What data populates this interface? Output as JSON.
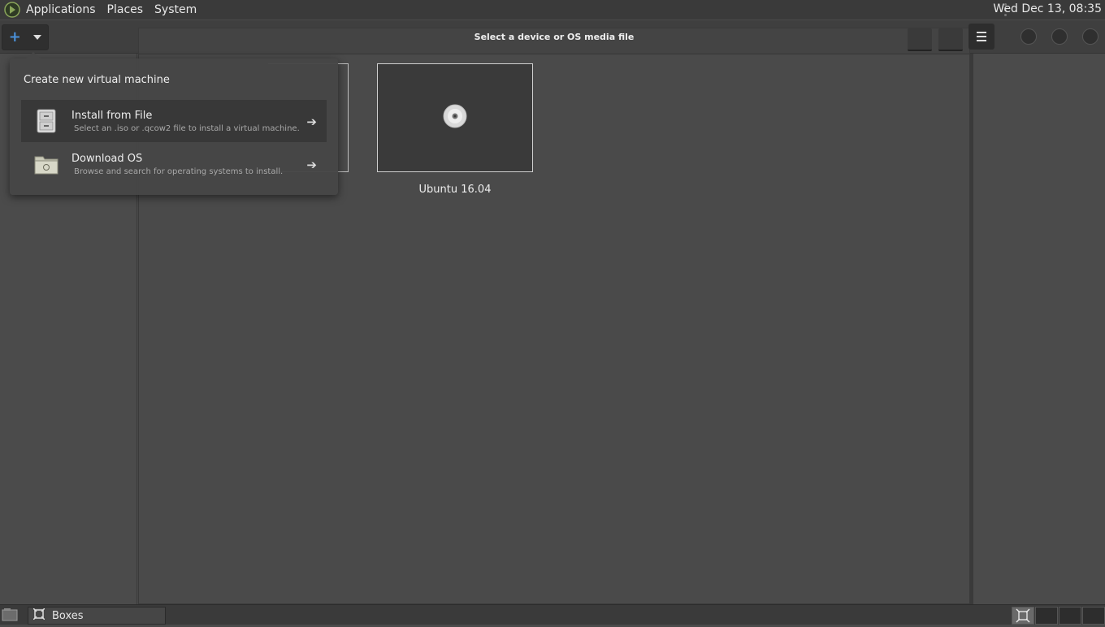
{
  "top_panel": {
    "menus": [
      "Applications",
      "Places",
      "System"
    ],
    "clock": "Wed Dec 13, 08:35"
  },
  "dialog": {
    "title": "Select a device or OS media file",
    "media": [
      {
        "label": "Ubuntu 16.04"
      }
    ]
  },
  "popover": {
    "title": "Create new virtual machine",
    "items": [
      {
        "label": "Install from File",
        "description": "Select an .iso or .qcow2 file to install a virtual machine."
      },
      {
        "label": "Download OS",
        "description": "Browse and search for operating systems to install."
      }
    ]
  },
  "taskbar": {
    "tasks": [
      {
        "label": "Boxes"
      }
    ]
  },
  "colors": {
    "accent": "#4a90d9",
    "panel": "#3a3a3a",
    "background": "#4a4a4a"
  }
}
